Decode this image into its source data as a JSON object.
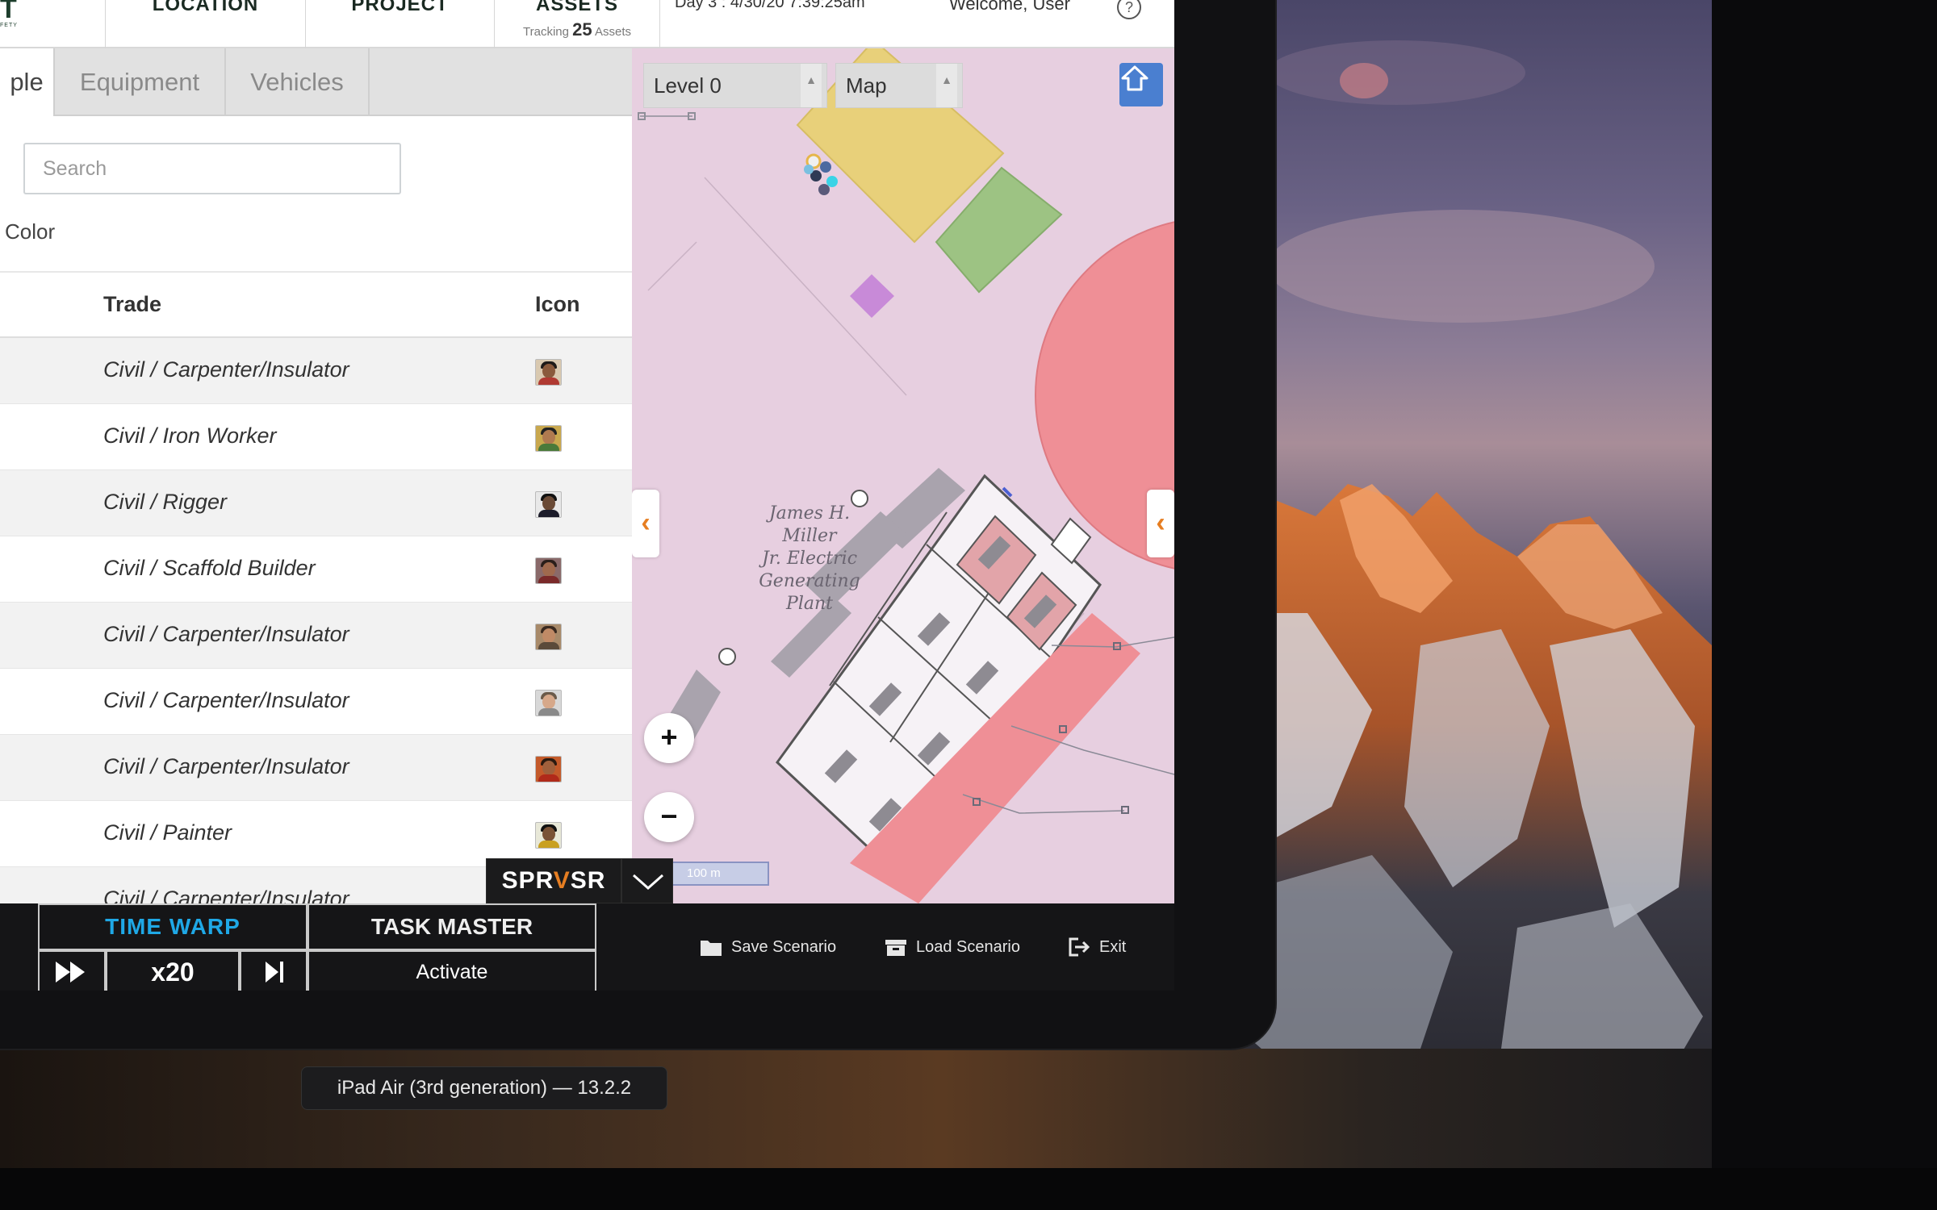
{
  "header": {
    "logo_text": "T",
    "logo_sub": "FETY",
    "nav": [
      "LOCATION",
      "PROJECT",
      "ASSETS"
    ],
    "tracking_prefix": "Tracking",
    "tracking_count": "25",
    "tracking_suffix": "Assets",
    "day_time": "Day 3 : 4/30/20 7:39:25am",
    "welcome": "Welcome, User",
    "help": "?"
  },
  "tabs": [
    "ple",
    "Equipment",
    "Vehicles"
  ],
  "search": {
    "placeholder": "Search",
    "value": ""
  },
  "filter": {
    "color_label": "Color"
  },
  "table": {
    "headers": {
      "trade": "Trade",
      "icon": "Icon"
    },
    "rows": [
      {
        "trade": "Civil / Carpenter/Insulator"
      },
      {
        "trade": "Civil / Iron Worker"
      },
      {
        "trade": "Civil / Rigger"
      },
      {
        "trade": "Civil / Scaffold Builder"
      },
      {
        "trade": "Civil / Carpenter/Insulator"
      },
      {
        "trade": "Civil / Carpenter/Insulator"
      },
      {
        "trade": "Civil / Carpenter/Insulator"
      },
      {
        "trade": "Civil / Painter"
      },
      {
        "trade": "Civil / Carpenter/Insulator"
      }
    ]
  },
  "map": {
    "level_select": "Level 0",
    "view_select": "Map",
    "site_label": [
      "James H.",
      "Miller",
      "Jr. Electric",
      "Generating",
      "Plant"
    ],
    "zoom_in": "+",
    "zoom_out": "−",
    "scale": "100 m",
    "colors": {
      "zone_yellow": "#e8d07a",
      "zone_green": "#9dc383",
      "zone_red": "#ef8f96",
      "zone_purple": "#c88ad8",
      "map_bg": "#e7cfe0"
    }
  },
  "brand": {
    "text_a": "SPR",
    "text_v": "V",
    "text_b": "SR"
  },
  "time_warp": {
    "title": "TIME WARP",
    "speed": "x20"
  },
  "task_master": {
    "title": "TASK MASTER",
    "action": "Activate"
  },
  "actions": {
    "save": "Save Scenario",
    "load": "Load Scenario",
    "exit": "Exit"
  },
  "device_label": "iPad Air (3rd generation) — 13.2.2"
}
